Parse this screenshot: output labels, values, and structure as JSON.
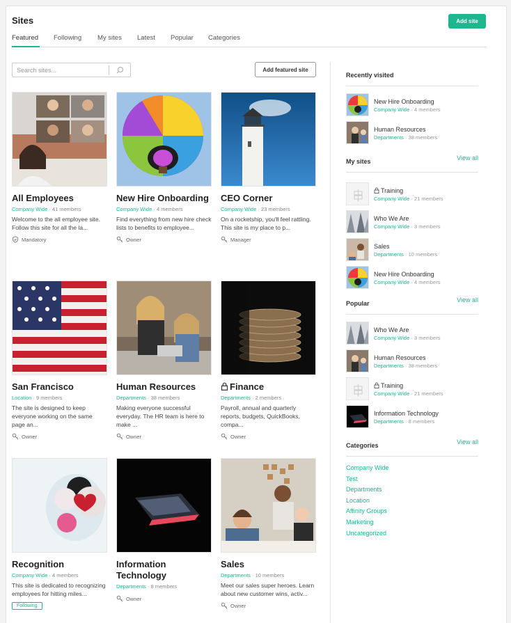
{
  "header": {
    "title": "Sites",
    "add_site_label": "Add site"
  },
  "tabs": [
    "Featured",
    "Following",
    "My sites",
    "Latest",
    "Popular",
    "Categories"
  ],
  "search": {
    "placeholder": "Search sites..."
  },
  "add_featured_label": "Add featured site",
  "colors": {
    "accent": "#1db68f"
  },
  "cards": [
    {
      "name": "All Employees",
      "category": "Company Wide",
      "members": "41 members",
      "desc": "Welcome to the all employee site. Follow this site for all the la...",
      "role": "Mandatory",
      "role_icon": "shield-check-icon"
    },
    {
      "name": "New Hire Onboarding",
      "category": "Company Wide",
      "members": "4 members",
      "desc": "Find everything from new hire check lists to benefits to employee...",
      "role": "Owner",
      "role_icon": "key-icon"
    },
    {
      "name": "CEO Corner",
      "category": "Company Wide",
      "members": "23 members",
      "desc": "On a rocketship, you'll feel rattling. This site is my place to p...",
      "role": "Manager",
      "role_icon": "key-icon"
    },
    {
      "name": "San Francisco",
      "category": "Location",
      "members": "9 members",
      "desc": "The site is designed to keep everyone working on the same page an...",
      "role": "Owner",
      "role_icon": "key-icon"
    },
    {
      "name": "Human Resources",
      "category": "Departments",
      "members": "38 members",
      "desc": "Making everyone successful everyday. The HR team is here to make ...",
      "role": "Owner",
      "role_icon": "key-icon"
    },
    {
      "name": "Finance",
      "category": "Departments",
      "members": "2 members",
      "desc": "Payroll, annual and quarterly reports, budgets, QuickBooks, compa...",
      "role": "Owner",
      "role_icon": "key-icon",
      "locked": true
    },
    {
      "name": "Recognition",
      "category": "Company Wide",
      "members": "4 members",
      "desc": "This site is dedicated to recognizing employees for hitting miles...",
      "badge": "Following"
    },
    {
      "name": "Information Technology",
      "category": "Departments",
      "members": "8 members",
      "desc": "",
      "role": "Owner",
      "role_icon": "key-icon"
    },
    {
      "name": "Sales",
      "category": "Departments",
      "members": "10 members",
      "desc": "Meet our sales super heroes. Learn about new customer wins, activ...",
      "role": "Owner",
      "role_icon": "key-icon"
    }
  ],
  "recently_visited": {
    "title": "Recently visited",
    "items": [
      {
        "name": "New Hire Onboarding",
        "category": "Company Wide",
        "members": "4 members"
      },
      {
        "name": "Human Resources",
        "category": "Departments",
        "members": "38 members"
      }
    ]
  },
  "my_sites": {
    "title": "My sites",
    "view_all": "View all",
    "items": [
      {
        "name": "Training",
        "category": "Company Wide",
        "members": "21 members"
      },
      {
        "name": "Who We Are",
        "category": "Company Wide",
        "members": "3 members"
      },
      {
        "name": "Sales",
        "category": "Departments",
        "members": "10 members"
      },
      {
        "name": "New Hire Onboarding",
        "category": "Company Wide",
        "members": "4 members"
      }
    ]
  },
  "popular": {
    "title": "Popular",
    "view_all": "View all",
    "items": [
      {
        "name": "Who We Are",
        "category": "Company Wide",
        "members": "3 members"
      },
      {
        "name": "Human Resources",
        "category": "Departments",
        "members": "38 members"
      },
      {
        "name": "Training",
        "category": "Company Wide",
        "members": "21 members"
      },
      {
        "name": "Information Technology",
        "category": "Departments",
        "members": "8 members"
      }
    ]
  },
  "categories": {
    "title": "Categories",
    "view_all": "View all",
    "items": [
      "Company Wide",
      "Test",
      "Departments",
      "Location",
      "Affinity Groups",
      "Marketing",
      "Uncategorized"
    ]
  }
}
